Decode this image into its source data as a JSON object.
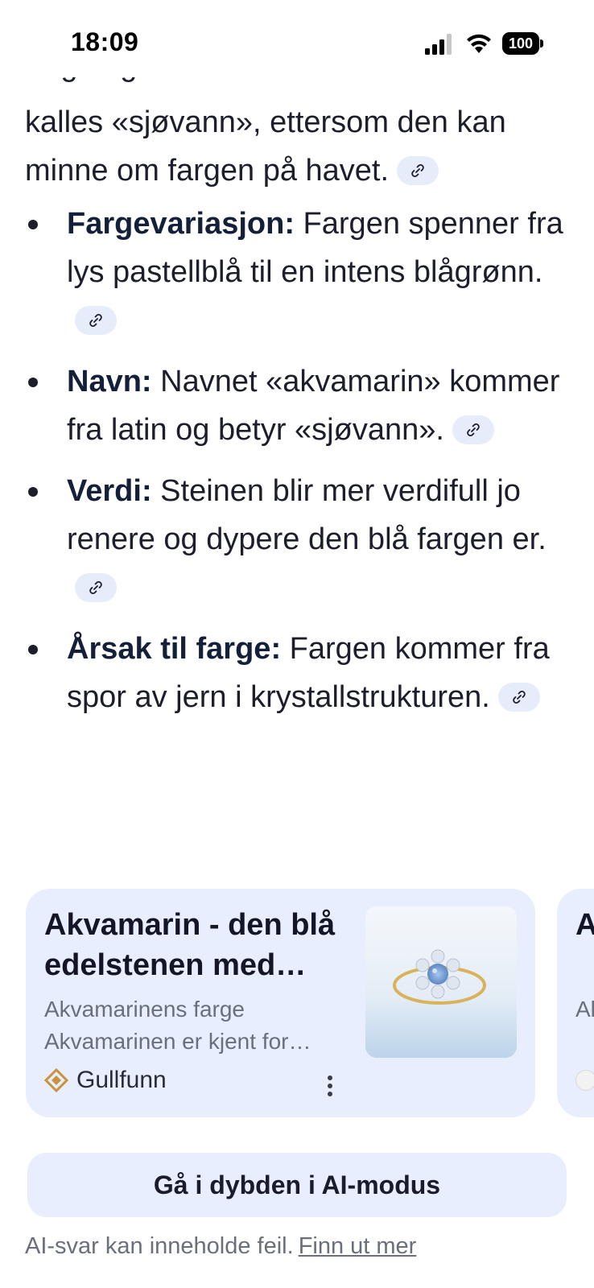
{
  "status_bar": {
    "time": "18:09",
    "battery": "100",
    "icons": [
      "signal-icon",
      "wifi-icon",
      "battery-icon"
    ]
  },
  "answer": {
    "intro": "kalles «sjøvann», ettersom den kan minne om fargen på havet.",
    "bullets": [
      {
        "term": "Fargevariasjon:",
        "text": " Fargen spenner fra lys pastellblå til en intens blågrønn."
      },
      {
        "term": "Navn:",
        "text": " Navnet «akvamarin» kommer fra latin og betyr «sjøvann»."
      },
      {
        "term": "Verdi:",
        "text": " Steinen blir mer verdifull jo renere og dypere den blå fargen er."
      },
      {
        "term": "Årsak til farge:",
        "text": " Fargen kommer fra spor av jern i krystallstrukturen."
      }
    ]
  },
  "source_cards": [
    {
      "title": "Akvamarin - den blå edelstenen med…",
      "snippet": "Akvamarinens farge Akvamarinen er kjent for…",
      "source": "Gullfunn"
    },
    {
      "title": "A B",
      "snippet": "Al Fa"
    }
  ],
  "ai_mode_button": "Gå i dybden i AI-modus",
  "disclaimer": {
    "text": "AI-svar kan inneholde feil.",
    "link": "Finn ut mer"
  },
  "colors": {
    "chip_bg": "#e7ecfb",
    "card_bg": "#e8eefd",
    "text": "#1d1e2c",
    "muted": "#6b6f7c",
    "source_logo": "#c8923f"
  }
}
